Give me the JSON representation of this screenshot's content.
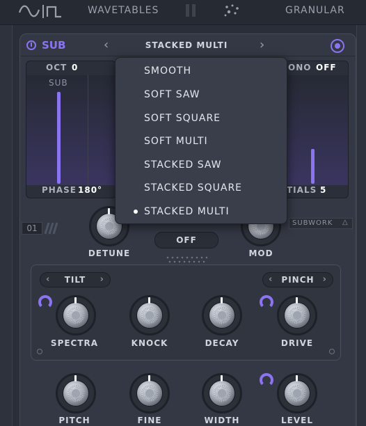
{
  "topbar": {
    "wavetables_label": "WAVETABLES",
    "granular_label": "GRANULAR"
  },
  "sub_panel": {
    "title": "SUB",
    "preset": "STACKED MULTI",
    "prev_icon": "chevron-left-icon",
    "next_icon": "chevron-right-icon"
  },
  "display_left": {
    "oct_label": "OCT",
    "oct_value": "0",
    "sub_label": "SUB",
    "phase_label": "PHASE",
    "phase_value": "180°"
  },
  "display_right": {
    "mono_label": "ONO",
    "mono_value": "OFF",
    "partials_label": "TIALS",
    "partials_value": "5"
  },
  "dropdown": {
    "items": [
      "SMOOTH",
      "SOFT SAW",
      "SOFT SQUARE",
      "SOFT MULTI",
      "STACKED SAW",
      "STACKED SQUARE",
      "STACKED MULTI"
    ],
    "selected": "STACKED MULTI"
  },
  "controls": {
    "slot_number": "01",
    "detune_label": "DETUNE",
    "off_button": "OFF",
    "mod_label": "MOD",
    "subwork_label": "SUBWORK"
  },
  "shaper": {
    "tilt_label": "TILT",
    "pinch_label": "PINCH",
    "knobs": [
      "SPECTRA",
      "KNOCK",
      "DECAY",
      "DRIVE"
    ]
  },
  "bottom_knobs": [
    "PITCH",
    "FINE",
    "WIDTH",
    "LEVEL"
  ],
  "colors": {
    "accent": "#8a74f0",
    "background": "#2a2e38",
    "panel": "#343844"
  }
}
